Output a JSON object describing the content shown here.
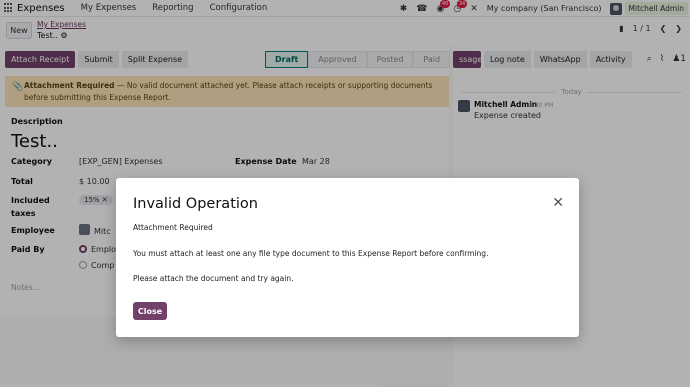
{
  "topbar": {
    "app_name": "Expenses",
    "menu": [
      "My Expenses",
      "Reporting",
      "Configuration"
    ],
    "badges": {
      "messages": "40",
      "activities": "34"
    },
    "company": "My company (San Francisco)",
    "user": "Mitchell Admin"
  },
  "control": {
    "new_label": "New",
    "breadcrumb_parent": "My Expenses",
    "breadcrumb_current": "Test..",
    "pager": "1 / 1"
  },
  "toolbar": {
    "buttons": [
      "Attach Receipt",
      "Submit",
      "Split Expense"
    ],
    "statuses": [
      "Draft",
      "Approved",
      "Posted",
      "Paid"
    ]
  },
  "alert": {
    "title": "Attachment Required",
    "text": " — No valid document attached yet. Please attach receipts or supporting documents before submitting this Expense Report."
  },
  "form": {
    "description_label": "Description",
    "description_value": "Test..",
    "category_label": "Category",
    "category_value": "[EXP_GEN] Expenses",
    "expense_date_label": "Expense Date",
    "expense_date_value": "Mar 28",
    "total_label": "Total",
    "total_value": "$ 10.00",
    "included_label_1": "Included",
    "included_label_2": "taxes",
    "tax_tag": "15% ✕",
    "employee_label": "Employee",
    "employee_value": "Mitc",
    "paid_by_label": "Paid By",
    "paid_by_option_1": "Emplo",
    "paid_by_option_2": "Comp",
    "notes_placeholder": "Notes..."
  },
  "chatter": {
    "tabs": [
      "ssage",
      "Log note",
      "WhatsApp",
      "Activity"
    ],
    "followers": "1",
    "date_separator": "Today",
    "message": {
      "author": "Mitchell Admin",
      "time": "8:30 PM",
      "body": "Expense created"
    }
  },
  "modal": {
    "title": "Invalid Operation",
    "subtitle": "Attachment Required",
    "line1": "You must attach at least one any file type document to this Expense Report before confirming.",
    "line2": "Please attach the document and try again.",
    "close_label": "Close"
  },
  "colors": {
    "primary": "#71416a",
    "alert_bg": "#fbe4b8",
    "status_active": "#017e84",
    "overlay": "rgba(0,0,0,0.3)"
  }
}
